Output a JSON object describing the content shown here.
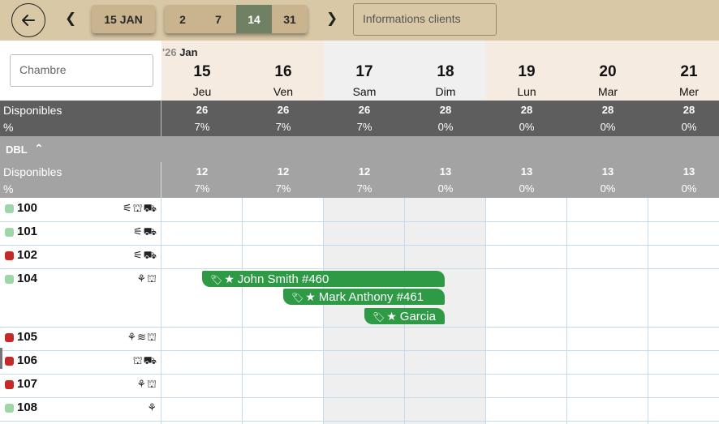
{
  "toolbar": {
    "back_icon": "arrow-left-circle-icon",
    "prev_icon": "chevron-left-icon",
    "next_icon": "chevron-right-icon",
    "date_button": "15 JAN",
    "range_options": [
      "2",
      "7",
      "14",
      "31"
    ],
    "range_selected": "14",
    "info_placeholder": "Informations clients"
  },
  "filter": {
    "room_placeholder": "Chambre"
  },
  "calendar": {
    "year_prefix": "'26",
    "month": "Jan",
    "days": [
      {
        "num": "15",
        "name": "Jeu",
        "weekend": false
      },
      {
        "num": "16",
        "name": "Ven",
        "weekend": false
      },
      {
        "num": "17",
        "name": "Sam",
        "weekend": true
      },
      {
        "num": "18",
        "name": "Dim",
        "weekend": true
      },
      {
        "num": "19",
        "name": "Lun",
        "weekend": false
      },
      {
        "num": "20",
        "name": "Mar",
        "weekend": false
      },
      {
        "num": "21",
        "name": "Mer",
        "weekend": false
      }
    ]
  },
  "summary": {
    "available_label": "Disponibles",
    "percent_label": "%",
    "available": [
      "26",
      "26",
      "26",
      "28",
      "28",
      "28",
      "28"
    ],
    "percent": [
      "7%",
      "7%",
      "7%",
      "0%",
      "0%",
      "0%",
      "0%"
    ]
  },
  "group": {
    "name": "DBL",
    "collapse_icon": "chevron-up-icon",
    "available_label": "Disponibles",
    "percent_label": "%",
    "available": [
      "12",
      "12",
      "12",
      "13",
      "13",
      "13",
      "13"
    ],
    "percent": [
      "7%",
      "7%",
      "7%",
      "0%",
      "0%",
      "0%",
      "0%"
    ]
  },
  "rooms": [
    {
      "number": "100",
      "status_color": "#9fd6a8",
      "icons": "⚟⛫⛟"
    },
    {
      "number": "101",
      "status_color": "#9fd6a8",
      "icons": "⚟⛟"
    },
    {
      "number": "102",
      "status_color": "#c62828",
      "icons": "⚟⛟"
    },
    {
      "number": "104",
      "status_color": "#9fd6a8",
      "icons": "⚘⛫"
    },
    {
      "number": "105",
      "status_color": "#c62828",
      "icons": "⚘≋⛫"
    },
    {
      "number": "106",
      "status_color": "#c62828",
      "icons": "⛫⛟"
    },
    {
      "number": "107",
      "status_color": "#c62828",
      "icons": "⚘⛫"
    },
    {
      "number": "108",
      "status_color": "#9fd6a8",
      "icons": "⚘"
    }
  ],
  "bookings": [
    {
      "label": "John Smith #460",
      "icons": [
        "tag-icon",
        "star-icon"
      ]
    },
    {
      "label": "Mark Anthony #461",
      "icons": [
        "tag-icon",
        "star-icon"
      ]
    },
    {
      "label": "Garcia",
      "icons": [
        "tag-icon",
        "star-icon"
      ]
    }
  ],
  "colors": {
    "toolbar_bg": "#d8c8a6",
    "booking_green": "#2e9a45",
    "summary_dark": "#5e5e5e",
    "summary_light": "#a3a3a3",
    "status_available": "#9fd6a8",
    "status_occupied": "#c62828"
  }
}
